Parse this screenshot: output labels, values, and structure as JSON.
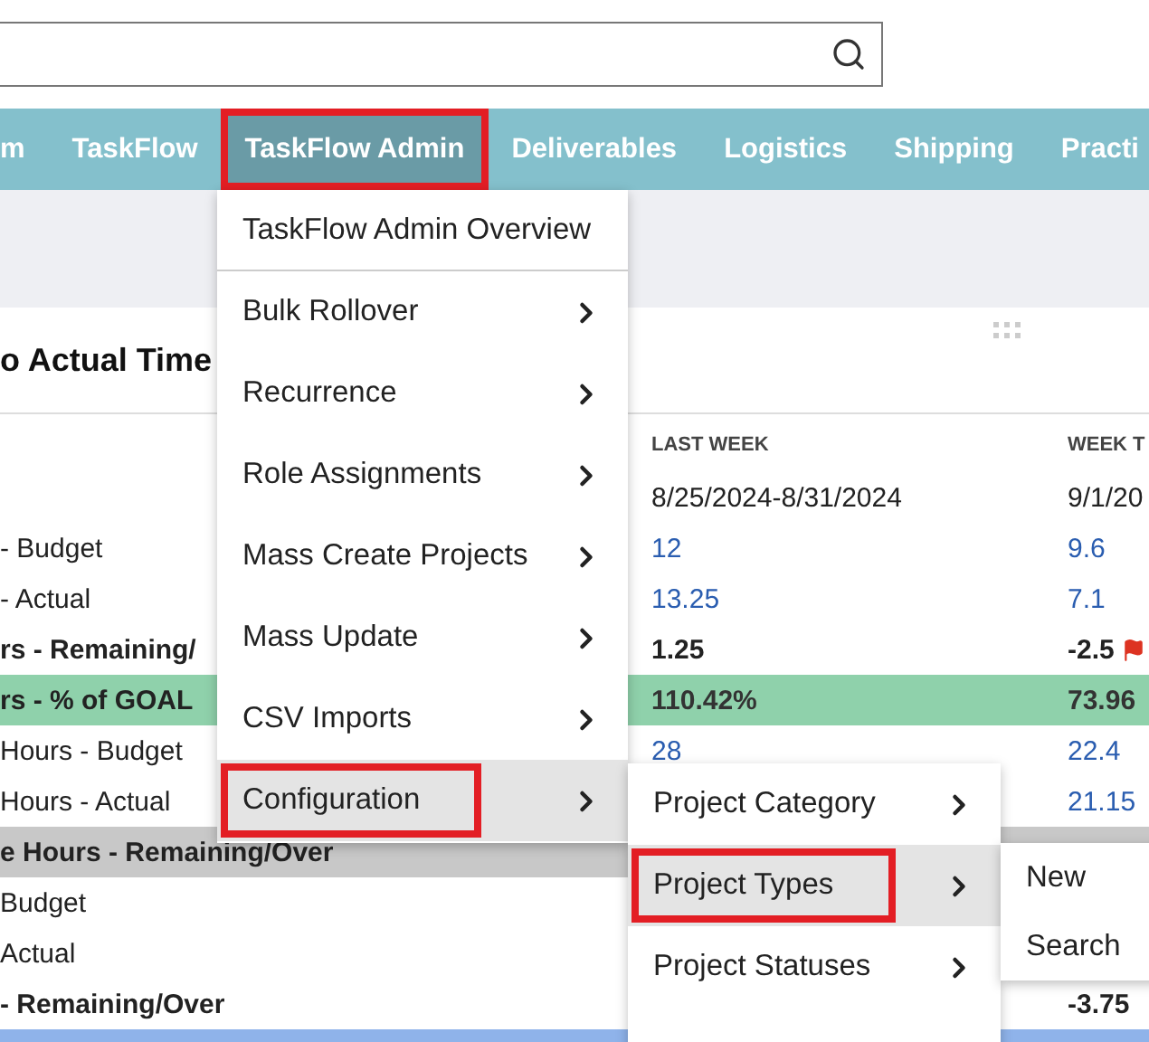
{
  "nav": {
    "items": [
      {
        "label": "m",
        "selected": false
      },
      {
        "label": "TaskFlow",
        "selected": false
      },
      {
        "label": "TaskFlow Admin",
        "selected": true
      },
      {
        "label": "Deliverables",
        "selected": false
      },
      {
        "label": "Logistics",
        "selected": false
      },
      {
        "label": "Shipping",
        "selected": false
      },
      {
        "label": "Practi",
        "selected": false
      }
    ]
  },
  "report": {
    "title": "o Actual Time",
    "columns": [
      "LAST WEEK",
      "WEEK T"
    ],
    "rows": [
      {
        "kind": "plain",
        "last_week": "8/25/2024-8/31/2024",
        "week_to": "9/1/20"
      },
      {
        "kind": "link",
        "label": "- Budget",
        "last_week": "12",
        "week_to": "9.6"
      },
      {
        "kind": "link",
        "label": "- Actual",
        "last_week": "13.25",
        "week_to": "7.1"
      },
      {
        "kind": "bold",
        "label": "rs - Remaining/",
        "last_week": "1.25",
        "week_to": "-2.5",
        "flag": true
      },
      {
        "kind": "goal",
        "label": "rs - % of GOAL",
        "last_week": "110.42%",
        "week_to": "73.96"
      },
      {
        "kind": "link",
        "label": "Hours - Budget",
        "last_week": "28",
        "week_to": "22.4"
      },
      {
        "kind": "link",
        "label": "Hours - Actual",
        "week_to": "21.15"
      },
      {
        "kind": "subtotal",
        "label": "e Hours - Remaining/Over"
      },
      {
        "kind": "link",
        "label": "Budget"
      },
      {
        "kind": "link",
        "label": "Actual"
      },
      {
        "kind": "bold",
        "label": "- Remaining/Over",
        "week_to": "-3.75"
      },
      {
        "kind": "blue"
      }
    ]
  },
  "menu": {
    "items": [
      {
        "label": "TaskFlow Admin Overview",
        "submenu": false,
        "selected": false
      },
      {
        "label": "Bulk Rollover",
        "submenu": true,
        "selected": false
      },
      {
        "label": "Recurrence",
        "submenu": true,
        "selected": false
      },
      {
        "label": "Role Assignments",
        "submenu": true,
        "selected": false
      },
      {
        "label": "Mass Create Projects",
        "submenu": true,
        "selected": false
      },
      {
        "label": "Mass Update",
        "submenu": true,
        "selected": false
      },
      {
        "label": "CSV Imports",
        "submenu": true,
        "selected": false
      },
      {
        "label": "Configuration",
        "submenu": true,
        "selected": true
      }
    ]
  },
  "submenu": {
    "items": [
      {
        "label": "Project Category",
        "submenu": true,
        "selected": false
      },
      {
        "label": "Project Types",
        "submenu": true,
        "selected": true
      },
      {
        "label": "Project Statuses",
        "submenu": true,
        "selected": false
      }
    ]
  },
  "submenu_2": {
    "items": [
      {
        "label": "New",
        "selected": false
      },
      {
        "label": "Search",
        "selected": false
      }
    ]
  }
}
